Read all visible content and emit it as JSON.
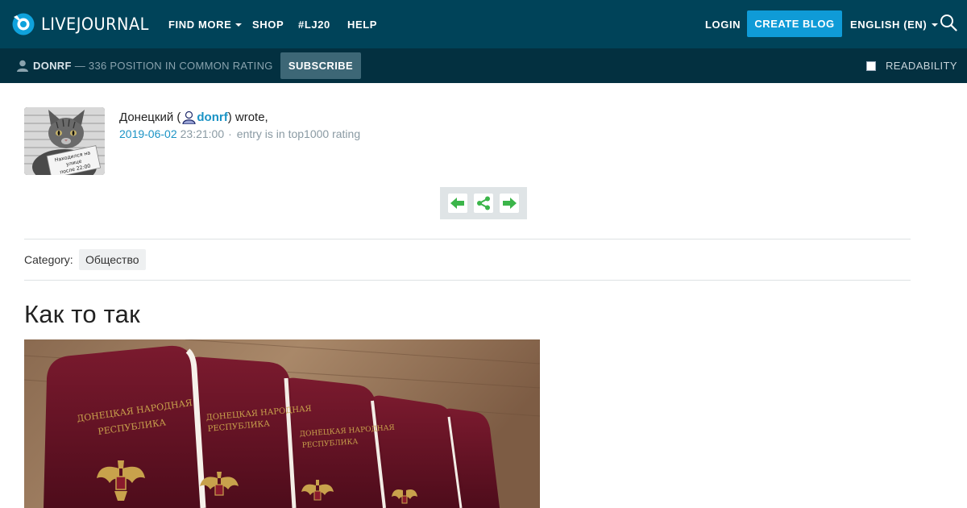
{
  "header": {
    "logo_text": "LIVEJOURNAL",
    "nav": [
      {
        "label": "FIND MORE",
        "has_caret": true
      },
      {
        "label": "SHOP"
      },
      {
        "label": "#LJ20"
      },
      {
        "label": "HELP"
      }
    ],
    "login_label": "LOGIN",
    "create_blog_label": "CREATE BLOG",
    "language_label": "ENGLISH (EN)",
    "search_icon": "search-icon"
  },
  "subbar": {
    "username": "DONRF",
    "rating_text": "— 336 POSITION IN COMMON RATING",
    "subscribe_label": "SUBSCRIBE",
    "readability_label": "READABILITY"
  },
  "entry": {
    "author_display": "Донецкий (",
    "author_login": "donrf",
    "wrote_text": ") wrote,",
    "date": "2019-06-02",
    "time": "23:21:00",
    "separator": "·",
    "rating_note": "entry is in top1000 rating",
    "avatar_sign_lines": [
      "Находился на",
      "улице",
      "после 22:00"
    ],
    "controls": [
      "prev-arrow-icon",
      "share-icon",
      "next-arrow-icon"
    ],
    "category_label": "Category:",
    "category_tag": "Общество",
    "title": "Как то так",
    "image_passport_lines": [
      "ДОНЕЦКАЯ НАРОДНАЯ",
      "РЕСПУБЛИКА"
    ]
  },
  "colors": {
    "topbar": "#004359",
    "subbar": "#033040",
    "accent": "#0f9bd7",
    "link": "#1a93c5",
    "controls_green": "#3bb54a",
    "passport": "#6e1226"
  }
}
